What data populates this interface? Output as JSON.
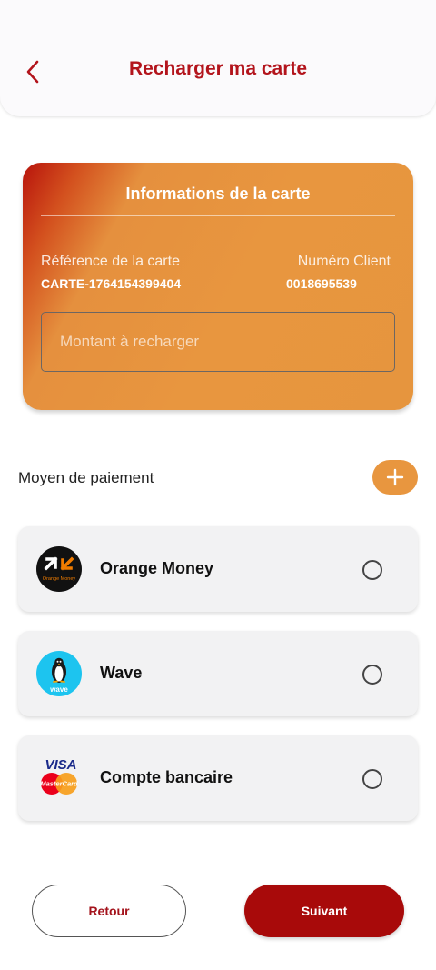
{
  "header": {
    "title": "Recharger ma carte",
    "back_icon": "chevron-left-icon"
  },
  "card": {
    "title": "Informations de la carte",
    "reference_label": "Référence de la carte",
    "reference_value": "CARTE-1764154399404",
    "client_label": "Numéro Client",
    "client_value": "0018695539",
    "amount_placeholder": "Montant à recharger",
    "amount_value": ""
  },
  "payment": {
    "section_label": "Moyen de paiement",
    "add_icon": "plus-icon",
    "methods": [
      {
        "label": "Orange Money",
        "logo": "orange-money-logo",
        "logo_caption": "Orange Money",
        "selected": false
      },
      {
        "label": "Wave",
        "logo": "wave-logo",
        "logo_caption": "wave",
        "selected": false
      },
      {
        "label": "Compte bancaire",
        "logo": "visa-mastercard-logo",
        "logo_caption": "VISA MasterCard",
        "selected": false
      }
    ]
  },
  "footer": {
    "back_label": "Retour",
    "next_label": "Suivant"
  },
  "colors": {
    "primary_red": "#b3141c",
    "accent_orange": "#e8963f",
    "button_red": "#a80a0a"
  }
}
